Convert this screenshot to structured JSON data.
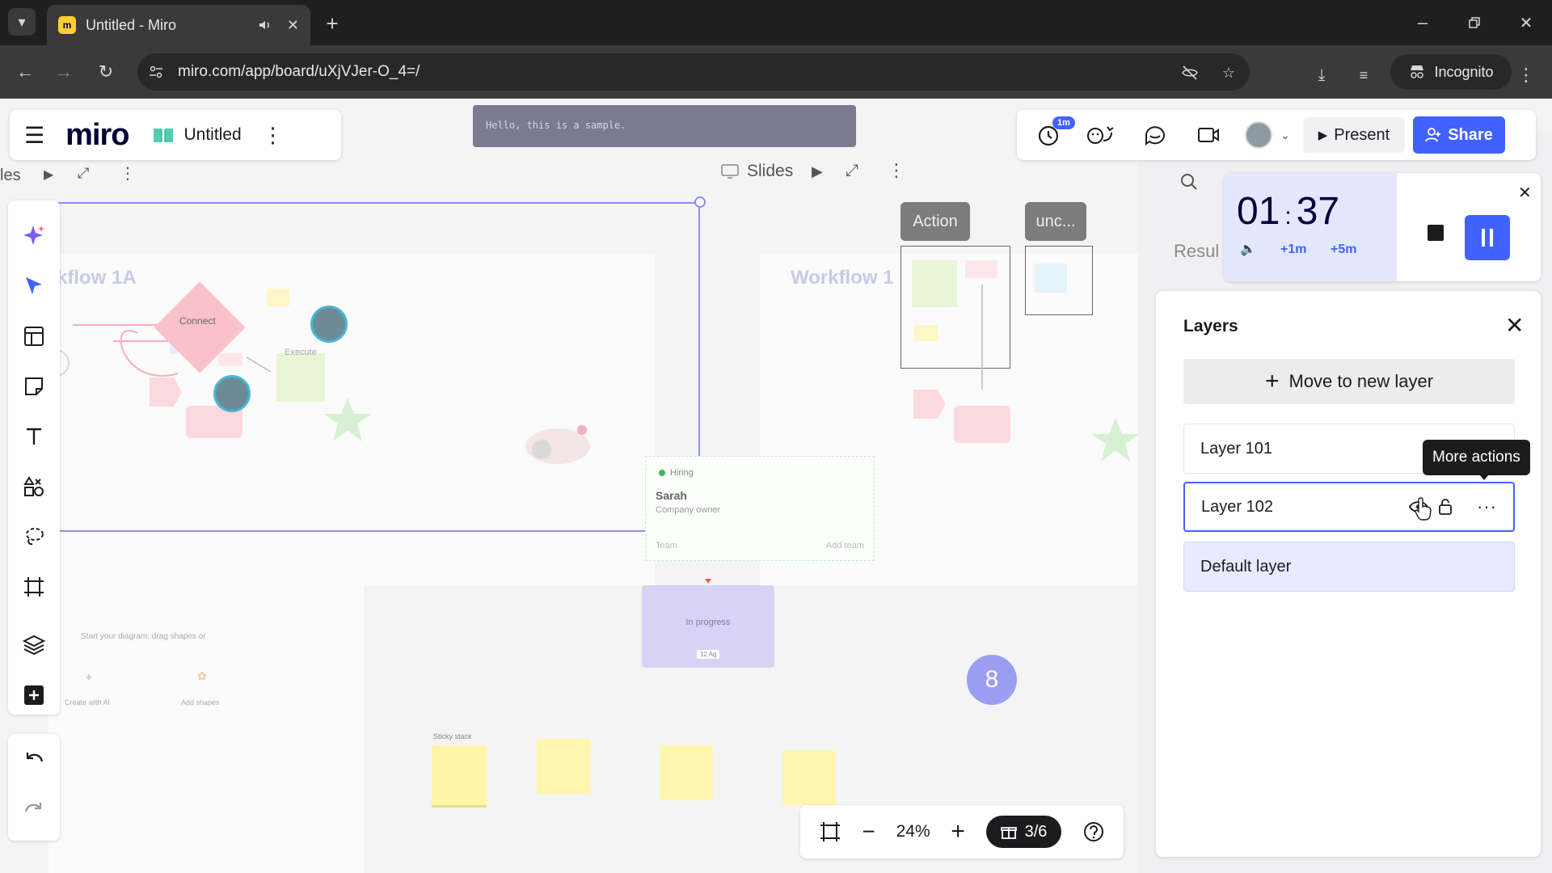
{
  "browser": {
    "tab_title": "Untitled - Miro",
    "favicon_letter": "m",
    "url": "miro.com/app/board/uXjVJer-O_4=/",
    "incognito_label": "Incognito"
  },
  "board": {
    "logo": "miro",
    "title": "Untitled",
    "code_note": "Hello, this is a sample.",
    "left_slides_label": "les",
    "slides_label": "Slides",
    "frame_labels": [
      "Action",
      "unc..."
    ],
    "workflow_left": "kflow 1A",
    "workflow_right": "Workflow 1",
    "connect_label": "Connect",
    "execute_label": "Execute",
    "hiring_tag": "Hiring",
    "card_name": "Sarah",
    "card_role": "Company owner",
    "card_team": "Team",
    "card_add_team": "Add team",
    "progress_label": "In progress",
    "progress_small": "12 Ag",
    "diagram_hint": "Start your diagram: drag shapes or",
    "create_ai": "Create with AI",
    "add_shapes": "Add shapes",
    "sticky_title": "Sticky stack",
    "counter_badge": "8",
    "search_placeholder": "Resul"
  },
  "header": {
    "timer_badge": "1m",
    "present_label": "Present",
    "share_label": "Share"
  },
  "timer": {
    "minutes": "01",
    "seconds": "37",
    "add_one": "+1m",
    "add_five": "+5m"
  },
  "layers": {
    "title": "Layers",
    "move_button": "Move to new layer",
    "items": [
      {
        "name": "Layer 101"
      },
      {
        "name": "Layer 102"
      },
      {
        "name": "Default layer"
      }
    ],
    "tooltip": "More actions"
  },
  "zoom": {
    "level": "24%",
    "pages": "3/6"
  },
  "colors": {
    "brand_blue": "#4262ff",
    "selection": "#8b8ff0",
    "default_layer_bg": "#e8eaff"
  }
}
